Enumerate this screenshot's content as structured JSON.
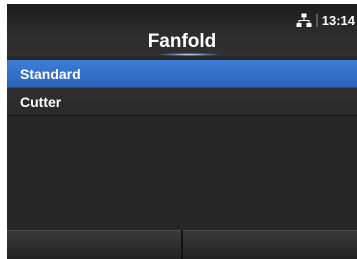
{
  "header": {
    "title": "Fanfold",
    "time": "13:14",
    "status_icons": [
      "network-icon",
      "separator-icon"
    ]
  },
  "menu": {
    "items": [
      {
        "label": "Standard",
        "selected": true
      },
      {
        "label": "Cutter",
        "selected": false
      }
    ]
  },
  "softkeys": {
    "left_label": "",
    "right_label": ""
  },
  "colors": {
    "background": "#262626",
    "selection": "#3473cc",
    "text": "#ffffff"
  }
}
